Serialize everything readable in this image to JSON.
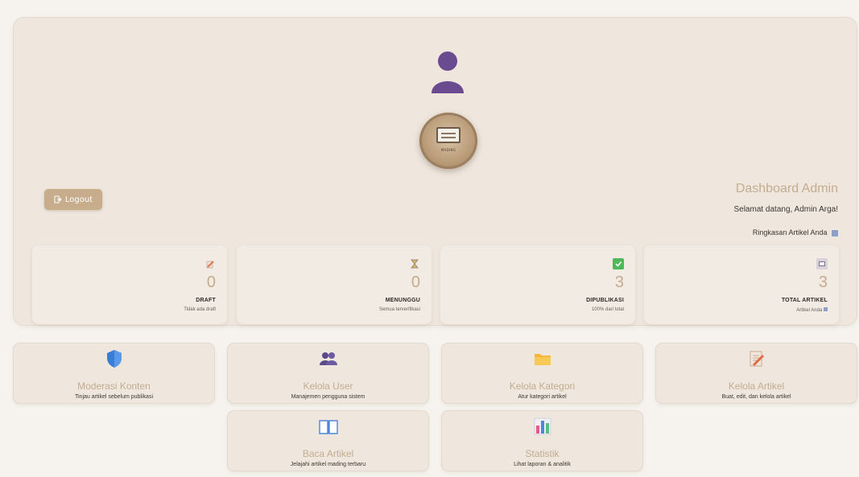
{
  "header": {
    "title": "Dashboard Admin",
    "welcome": "Selamat datang, Admin Arga!",
    "summary_label": "Ringkasan Artikel Anda",
    "logout_label": "Logout",
    "logo_text": "MADING"
  },
  "stats": [
    {
      "icon": "newspaper-icon",
      "value": "3",
      "label": "TOTAL ARTIKEL",
      "sub": "Artikel Anda"
    },
    {
      "icon": "check-icon",
      "value": "3",
      "label": "DIPUBLIKASI",
      "sub": "100% dari total"
    },
    {
      "icon": "hourglass-icon",
      "value": "0",
      "label": "MENUNGGU",
      "sub": "Semua terverifikasi"
    },
    {
      "icon": "pencil-icon",
      "value": "0",
      "label": "DRAFT",
      "sub": "Tidak ada draft"
    }
  ],
  "menu": [
    {
      "icon": "memo-icon",
      "title": "Kelola Artikel",
      "desc": "Buat, edit, dan kelola artikel"
    },
    {
      "icon": "folder-icon",
      "title": "Kelola Kategori",
      "desc": "Atur kategori artikel"
    },
    {
      "icon": "users-icon",
      "title": "Kelola User",
      "desc": "Manajemen pengguna sistem"
    },
    {
      "icon": "shield-icon",
      "title": "Moderasi Konten",
      "desc": "Tinjau artikel sebelum publikasi"
    },
    {
      "icon": "bar-chart-icon",
      "title": "Statistik",
      "desc": "Lihat laporan & analitik"
    },
    {
      "icon": "book-icon",
      "title": "Baca Artikel",
      "desc": "Jelajahi artikel mading terbaru"
    }
  ],
  "colors": {
    "background": "#f6f3ee",
    "card": "#efe7de",
    "accent": "#c3ab8f",
    "button": "#c8ad8d",
    "text": "#3d3631"
  }
}
